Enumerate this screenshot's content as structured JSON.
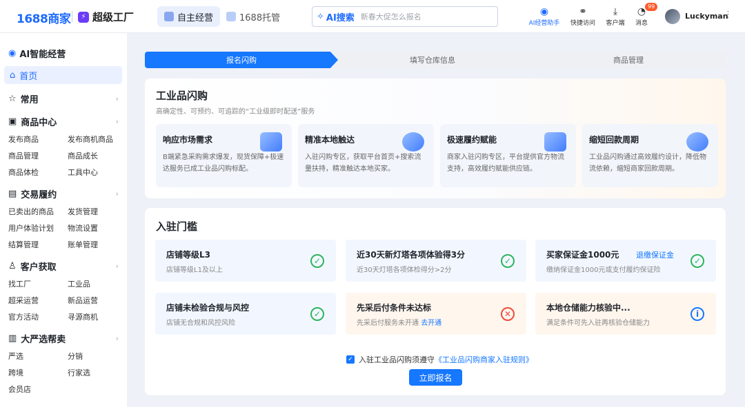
{
  "header": {
    "logo": "1688商家",
    "sub_brand": "超级工厂",
    "sub_brand_badge": "⚡",
    "tabs": [
      {
        "label": "自主经营",
        "active": true
      },
      {
        "label": "1688托管",
        "active": false
      }
    ],
    "search": {
      "ai_label": "AI搜索",
      "placeholder": "新春大促怎么报名"
    },
    "tools": [
      {
        "label": "AI经营助手",
        "icon": "robot-icon"
      },
      {
        "label": "快捷访问",
        "icon": "link-icon"
      },
      {
        "label": "客户端",
        "icon": "download-icon"
      },
      {
        "label": "消息",
        "icon": "message-icon",
        "badge": "99"
      }
    ],
    "user": "Luckyman"
  },
  "sidebar": {
    "title": "AI智能经营",
    "home": "首页",
    "sections": [
      {
        "label": "常用",
        "items": []
      },
      {
        "label": "商品中心",
        "items": [
          "发布商品",
          "发布商机商品",
          "商品管理",
          "商品成长",
          "商品体检",
          "工具中心"
        ]
      },
      {
        "label": "交易履约",
        "items": [
          "已卖出的商品",
          "发货管理",
          "用户体验计划",
          "物流设置",
          "结算管理",
          "账单管理"
        ]
      },
      {
        "label": "客户获取",
        "items": [
          "找工厂",
          "工业品",
          "超采运营",
          "新品运营",
          "官方活动",
          "寻源商机"
        ]
      },
      {
        "label": "大严选帮卖",
        "items": [
          "严选",
          "分销",
          "跨境",
          "行家选",
          "会员店"
        ]
      }
    ]
  },
  "steps": [
    "报名闪购",
    "填写仓库信息",
    "商品管理"
  ],
  "intro": {
    "title": "工业品闪购",
    "subtitle": "高确定性、可预约、可追踪的“工业级即时配送”服务",
    "features": [
      {
        "title": "响应市场需求",
        "desc": "B端紧急采购需求爆发，现货保障+极速达服务已成工业品闪购标配。"
      },
      {
        "title": "精准本地触达",
        "desc": "入驻闪购专区，获取平台首页+搜索流量扶持，精准触达本地买家。"
      },
      {
        "title": "极速履约赋能",
        "desc": "商家入驻闪购专区，平台提供官方物流支持，高效履约赋能供应链。"
      },
      {
        "title": "缩短回款周期",
        "desc": "工业品闪购通过高效履约设计，降低物流依赖，缩短商家回款周期。"
      }
    ]
  },
  "threshold": {
    "title": "入驻门槛",
    "requirements": [
      {
        "title": "店铺等级L3",
        "desc": "店铺等级L1及以上",
        "status": "ok"
      },
      {
        "title": "近30天新灯塔各项体验得3分",
        "desc": "近30天灯塔各项体检得分>2分",
        "status": "ok"
      },
      {
        "title": "买家保证金1000元",
        "link": "退缴保证金",
        "desc": "缴纳保证金1000元或支付履约保证险",
        "status": "ok"
      },
      {
        "title": "店铺未检验合规与风控",
        "desc": "店铺无合规和风控风险",
        "status": "ok"
      },
      {
        "title": "先采后付条件未达标",
        "desc": "先采后付服务未开通",
        "desc_link": "去开通",
        "status": "fail"
      },
      {
        "title": "本地仓储能力核验中...",
        "desc": "满足条件可先入驻再核验仓储能力",
        "status": "info"
      }
    ],
    "agreement": {
      "text": "入驻工业品闪购须遵守",
      "link": "《工业品闪购商家入驻规则》"
    },
    "apply_label": "立即报名"
  }
}
